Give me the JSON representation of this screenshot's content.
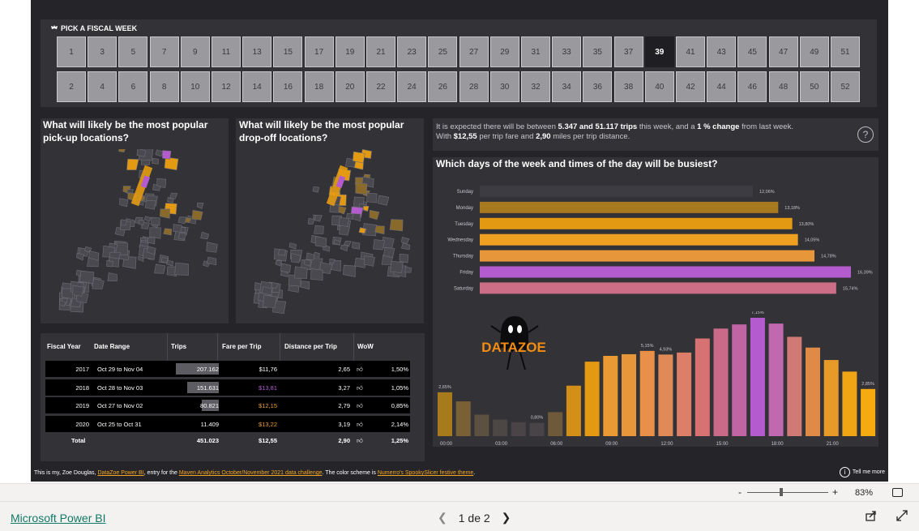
{
  "slicer": {
    "title": "PICK A FISCAL WEEK",
    "selected": "39",
    "row1": [
      "1",
      "3",
      "5",
      "7",
      "9",
      "11",
      "13",
      "15",
      "17",
      "19",
      "21",
      "23",
      "25",
      "27",
      "29",
      "31",
      "33",
      "35",
      "37",
      "39",
      "41",
      "43",
      "45",
      "47",
      "49",
      "51"
    ],
    "row2": [
      "2",
      "4",
      "6",
      "8",
      "10",
      "12",
      "14",
      "16",
      "18",
      "20",
      "22",
      "24",
      "26",
      "28",
      "30",
      "32",
      "34",
      "36",
      "38",
      "40",
      "42",
      "44",
      "46",
      "48",
      "50",
      "52"
    ]
  },
  "pickup": {
    "title": "What will likely be the most popular pick-up locations?"
  },
  "dropoff": {
    "title": "What will likely be the most popular drop-off locations?"
  },
  "table": {
    "headers": [
      "Fiscal Year",
      "Date Range",
      "Trips",
      "Fare per Trip",
      "Distance per Trip",
      "WoW"
    ],
    "rows": [
      {
        "year": "2017",
        "range": "Oct 29 to Nov 04",
        "trips": "207.162",
        "trips_frac": 0.98,
        "fare": "$11,76",
        "fare_color": "#ffffff",
        "dist": "2,65",
        "wow": "1,50%"
      },
      {
        "year": "2018",
        "range": "Oct 28 to Nov 03",
        "trips": "151.631",
        "trips_frac": 0.72,
        "fare": "$13,81",
        "fare_color": "#b35bd1",
        "dist": "3,27",
        "wow": "1,05%"
      },
      {
        "year": "2019",
        "range": "Oct 27 to Nov 02",
        "trips": "80.821",
        "trips_frac": 0.39,
        "fare": "$12,15",
        "fare_color": "#e8a13a",
        "dist": "2,79",
        "wow": "0,85%"
      },
      {
        "year": "2020",
        "range": "Oct 25 to Oct 31",
        "trips": "11.409",
        "trips_frac": 0.0,
        "fare": "$13,22",
        "fare_color": "#e8a13a",
        "dist": "3,19",
        "wow": "2,14%"
      }
    ],
    "total": {
      "label": "Total",
      "trips": "451.023",
      "fare": "$12,55",
      "dist": "2,90",
      "wow": "1,25%"
    }
  },
  "info": {
    "t1": "It is expected there will be between ",
    "b1": "5.347 and 51.117 trips",
    "t2": " this week, and a ",
    "b2": "1 % change",
    "t3": " from last week.",
    "t4": "With ",
    "b3": "$12,55",
    "t5": " per trip fare and ",
    "b4": "2,90",
    "t6": " miles per trip distance.",
    "help": "?"
  },
  "busy": {
    "title": "Which days of the week and times of the day will be busiest?"
  },
  "logo": {
    "text": "DATAZOE"
  },
  "chart_data": [
    {
      "type": "bar",
      "orientation": "horizontal",
      "categories": [
        "Sunday",
        "Monday",
        "Tuesday",
        "Wednesday",
        "Thursday",
        "Friday",
        "Saturday"
      ],
      "values": [
        12.06,
        13.18,
        13.8,
        14.05,
        14.78,
        16.39,
        15.74
      ],
      "labels": [
        "12,06%",
        "13,18%",
        "13,80%",
        "14,05%",
        "14,78%",
        "16,39%",
        "15,74%"
      ],
      "colors": [
        "#3d3c42",
        "#a87a1f",
        "#e39a12",
        "#f0a020",
        "#e8963a",
        "#b45bd0",
        "#cc6e86"
      ]
    },
    {
      "type": "bar",
      "categories": [
        "00:00",
        "01:00",
        "02:00",
        "03:00",
        "04:00",
        "05:00",
        "06:00",
        "07:00",
        "08:00",
        "09:00",
        "10:00",
        "11:00",
        "12:00",
        "13:00",
        "14:00",
        "15:00",
        "16:00",
        "17:00",
        "18:00",
        "19:00",
        "20:00",
        "21:00",
        "22:00",
        "23:00"
      ],
      "values": [
        2.65,
        2.1,
        1.3,
        1.0,
        0.85,
        0.8,
        1.45,
        3.05,
        4.5,
        4.85,
        4.95,
        5.15,
        4.93,
        5.05,
        5.9,
        6.5,
        6.75,
        7.15,
        6.8,
        6.0,
        5.35,
        4.6,
        3.9,
        2.85
      ],
      "point_labels": {
        "0": "2,65%",
        "5": "0,80%",
        "11": "5,15%",
        "12": "4,93%",
        "17": "7,15%",
        "23": "2,85%"
      },
      "xticks": [
        "00:00",
        "03:00",
        "06:00",
        "09:00",
        "12:00",
        "15:00",
        "18:00",
        "21:00"
      ]
    }
  ],
  "footer": {
    "t1": "This is my, Zoe Douglas, ",
    "l1": "DataZoe Power BI",
    "t2": ", entry for the ",
    "l2": "Maven Analytics October/November 2021 data challenge",
    "t3": ". The color scheme is ",
    "l3": "Numerro's SpookySlicer festive theme",
    "t4": ".",
    "tell": "Tell me more"
  },
  "zoom": {
    "minus": "-",
    "plus": "+",
    "value": "83%",
    "level": 0.83
  },
  "app": {
    "brand": "Microsoft Power BI",
    "page": "1 de 2"
  }
}
